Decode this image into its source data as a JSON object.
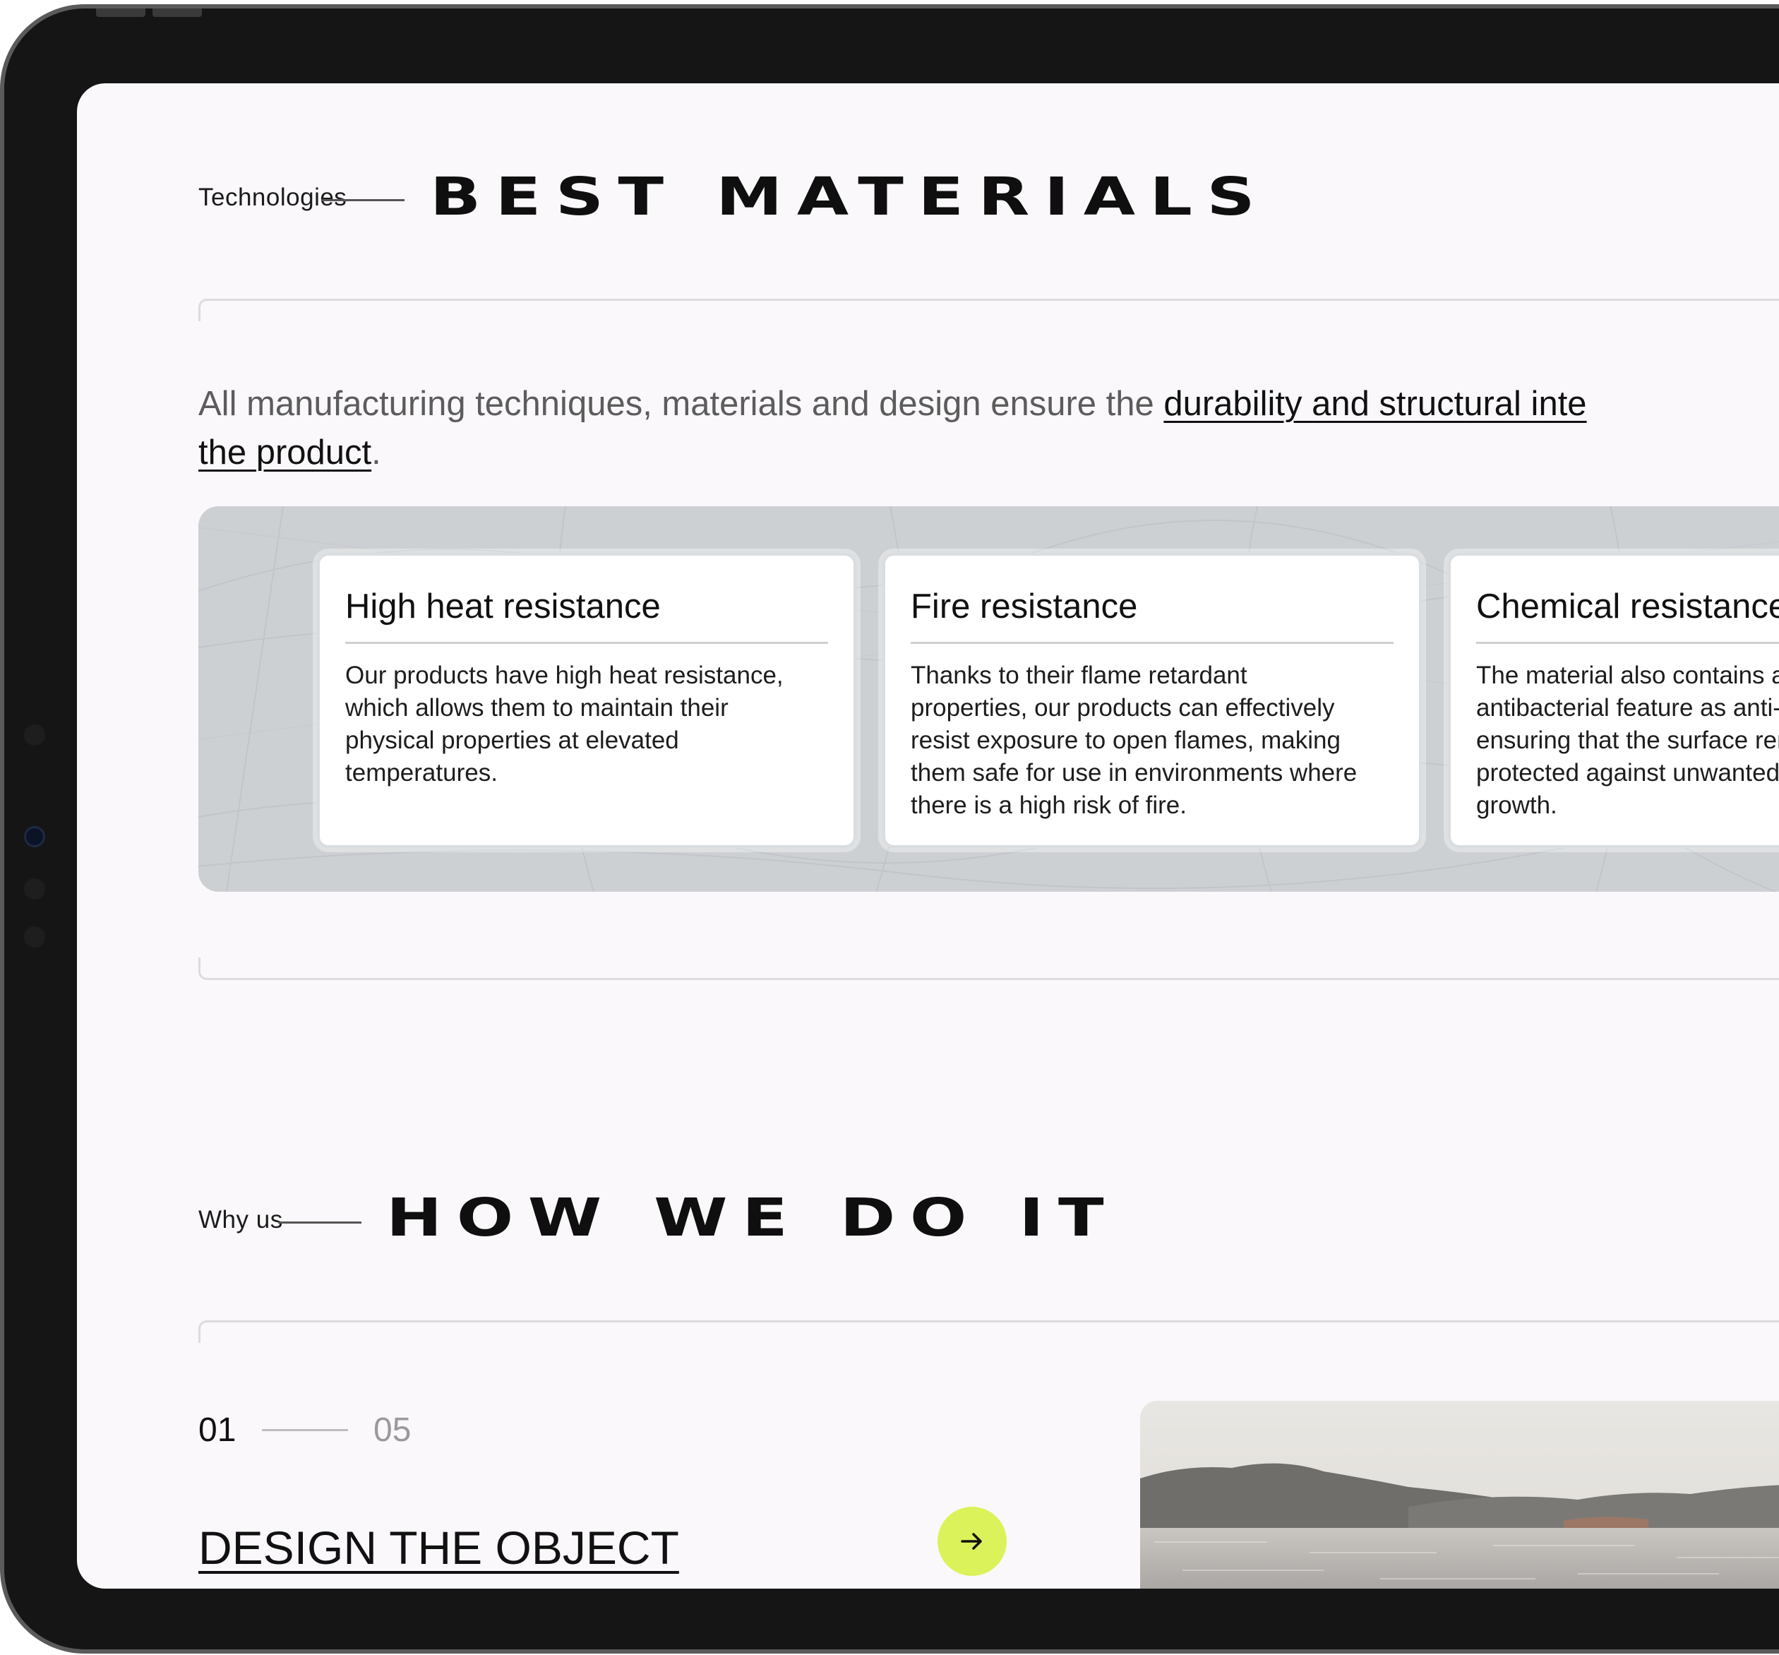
{
  "materials": {
    "eyebrow": "Technologies",
    "title": "BEST MATERIALS",
    "lead_plain": "All manufacturing techniques, materials and design ensure the ",
    "lead_emph_1": "durability and structural inte",
    "lead_emph_2": "the product",
    "lead_end": ".",
    "cards": [
      {
        "title": "High heat resistance",
        "lines": [
          "Our products have high heat resistance,",
          "which allows them to maintain their",
          "physical properties at elevated",
          "temperatures."
        ]
      },
      {
        "title": "Fire resistance",
        "lines": [
          "Thanks to their flame retardant",
          "properties, our products can effectively",
          "resist exposure to open flames, making",
          "them safe for use in environments where",
          "there is a high risk of fire."
        ]
      },
      {
        "title": "Chemical resistance",
        "lines": [
          "The material also contains an",
          "antibacterial feature as anti-fouli",
          "ensuring that the surface  remain",
          "protected against unwanted biolo",
          "growth."
        ]
      }
    ]
  },
  "process": {
    "eyebrow": "Why us",
    "title": "HOW WE DO IT",
    "counter_current": "01",
    "counter_total": "05",
    "step_title": "DESIGN THE OBJECT",
    "next_icon": "arrow-right-icon"
  },
  "colors": {
    "device": "#151515",
    "screen_bg": "#faf8fb",
    "panel_bg": "#cdd0d3",
    "accent": "#dcf25a"
  }
}
